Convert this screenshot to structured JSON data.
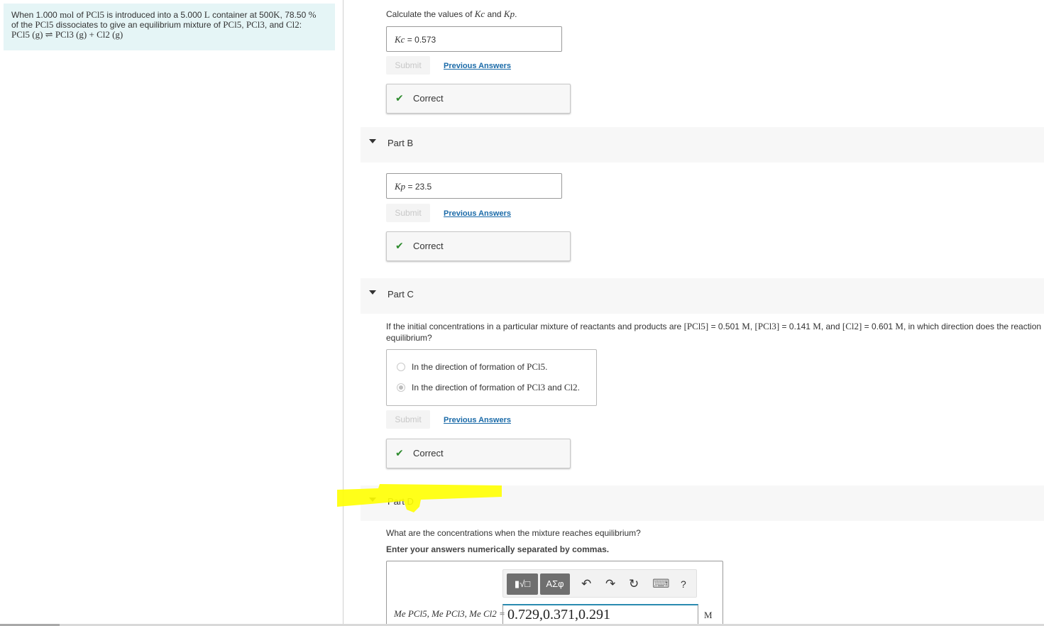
{
  "colors": {
    "problem_bg": "#e5f5f6",
    "part_header_bg": "#f7f7f7",
    "link": "#1a6aa8",
    "check": "#2e8b2e",
    "highlighter": "#ffff00",
    "input_focus": "#2a8ab0"
  },
  "problem": {
    "t1": "When 1.000",
    "m1": "mol",
    "t2": "of",
    "m2": "PCl5",
    "t3": "is introduced into a 5.000",
    "m3": "L",
    "t4": "container at 500",
    "m4": "K",
    "t5": ", 78.50",
    "m5": "%",
    "t6": "of the",
    "m6": "PCl5",
    "t7": "dissociates to give an equilibrium mixture of",
    "m7": "PCl5",
    "t8": ",",
    "m8": "PCl3",
    "t9": ", and",
    "m9": "Cl2",
    "t10": ":",
    "equation": "PCl5 (g) ⇌ PCl3 (g) + Cl2 (g)"
  },
  "partA": {
    "prompt_t1": "Calculate the values of",
    "kc_symbol": "Kc",
    "prompt_t2": "and",
    "kp_symbol": "Kp",
    "prompt_t3": ".",
    "answer_label": "Kc",
    "answer_eq": "=",
    "answer_value": "0.573",
    "submit_label": "Submit",
    "prev_label": "Previous Answers",
    "correct_label": "Correct"
  },
  "partB": {
    "header": "Part B",
    "answer_label": "Kp",
    "answer_eq": "=",
    "answer_value": "23.5",
    "submit_label": "Submit",
    "prev_label": "Previous Answers",
    "correct_label": "Correct"
  },
  "partC": {
    "header": "Part C",
    "prompt_t1": "If the initial concentrations in a particular mixture of reactants and products are",
    "c1": "[PCl5]",
    "eq1": "= 0.501",
    "u1": "M",
    "c2": "[PCl3]",
    "eq2": "= 0.141",
    "u2": "M",
    "and": ", and",
    "c3": "[Cl2]",
    "eq3": "= 0.601",
    "u3": "M",
    "prompt_t2": ", in which direction does the reaction",
    "prompt_line2": "equilibrium?",
    "choice1_text": "In the direction of formation of",
    "choice1_species": "PCl5",
    "choice2_text": "In the direction of formation of",
    "choice2_species1": "PCl3",
    "choice2_and": "and",
    "choice2_species2": "Cl2",
    "selected_choice": 2,
    "submit_label": "Submit",
    "prev_label": "Previous Answers",
    "correct_label": "Correct"
  },
  "partD": {
    "header": "Part D",
    "prompt": "What are the concentrations when the mixture reaches equilibrium?",
    "instruction": "Enter your answers numerically separated by commas.",
    "toolbar": {
      "template_label": "▮√□",
      "greek_label": "ΑΣφ",
      "undo_icon": "↶",
      "redo_icon": "↷",
      "reset_icon": "↻",
      "keyboard_icon": "⌨",
      "help_label": "?"
    },
    "answer_label": "Me PCl5, Me PCl3, Me Cl2 =",
    "answer_value": "0.729,0.371,0.291",
    "unit": "M"
  }
}
